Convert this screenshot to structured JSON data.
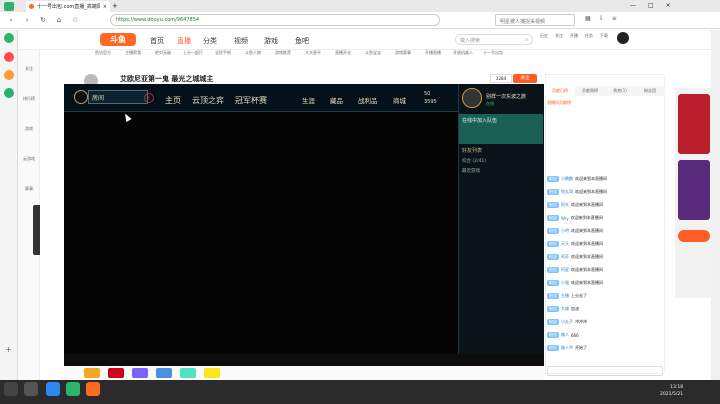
{
  "browser": {
    "tab_title": "十一号出包.com直播_高端局游戏门户",
    "url": "https://www.douyu.com/9647854",
    "search_placeholder": "明星被人捕捉采视频",
    "tab_count": "1"
  },
  "site": {
    "logo": "斗鱼",
    "nav": [
      "首页",
      "直播",
      "分类",
      "视频",
      "游戏",
      "鱼吧"
    ],
    "search_placeholder": "输入搜索",
    "actions": [
      "历史",
      "关注",
      "开播",
      "任务",
      "下载"
    ]
  },
  "left_rail": [
    "关注",
    "排行榜",
    "游戏",
    "云游戏",
    "赛事"
  ],
  "room": {
    "title": "艾欧尼亚第一鬼 最光之城城主",
    "meta": "主播",
    "follow": "关注",
    "count": "3284"
  },
  "categories": [
    "鱼坑官方",
    "主播帮我",
    "绝对无敌",
    "上分一起打",
    "全民手柄",
    "斗鱼人物",
    "游戏推荐",
    "大大直平",
    "直播开业",
    "斗鱼宝宝",
    "游戏赛事",
    "开播直播",
    "开放机器人",
    "十一号出包",
    "十二号出包",
    "斗鱼月票"
  ],
  "lol": {
    "room_btn": "房间",
    "tabs": [
      "主页",
      "云顶之弈",
      "冠军杯赛"
    ],
    "right_tabs": [
      "生涯",
      "藏品",
      "战利品",
      "商城"
    ],
    "currency_rp": "50",
    "currency_be": "3595",
    "player_name": "别样一次东波之旅",
    "status": "在线",
    "friend_group": "好友列表",
    "groups": [
      "综合 (2/41)",
      "最近游戏"
    ],
    "note": "在线中加入队伍"
  },
  "right": {
    "tabs": [
      "贡献日榜",
      "贡献周榜",
      "贵宾(1)",
      "粉丝团"
    ],
    "rank_title": "直播间贡献榜",
    "chat": [
      {
        "badge": "粉丝",
        "name": "小鹏鹏",
        "text": "欢迎来到本直播间"
      },
      {
        "badge": "粉丝",
        "name": "鱼丸哥",
        "text": "欢迎来到本直播间"
      },
      {
        "badge": "粉丝",
        "name": "阿东",
        "text": "欢迎来到本直播间"
      },
      {
        "badge": "粉丝",
        "name": "Wry",
        "text": "欢迎来到本直播间"
      },
      {
        "badge": "粉丝",
        "name": "小明",
        "text": "欢迎来到本直播间"
      },
      {
        "badge": "粉丝",
        "name": "天天",
        "text": "欢迎来到本直播间"
      },
      {
        "badge": "粉丝",
        "name": "阿芳",
        "text": "欢迎来到本直播间"
      },
      {
        "badge": "粉丝",
        "name": "阿星",
        "text": "欢迎来到本直播间"
      },
      {
        "badge": "粉丝",
        "name": "小强",
        "text": "欢迎来到本直播间"
      },
      {
        "badge": "粉丝",
        "name": "主播",
        "text": "上分去了"
      },
      {
        "badge": "粉丝",
        "name": "大雄",
        "text": "加油"
      },
      {
        "badge": "粉丝",
        "name": "小丸子",
        "text": "冲冲冲"
      },
      {
        "badge": "粉丝",
        "name": "路人",
        "text": "666"
      },
      {
        "badge": "粉丝",
        "name": "路人甲",
        "text": "开始了"
      }
    ]
  },
  "time": "13:18",
  "date": "2021/5/21"
}
